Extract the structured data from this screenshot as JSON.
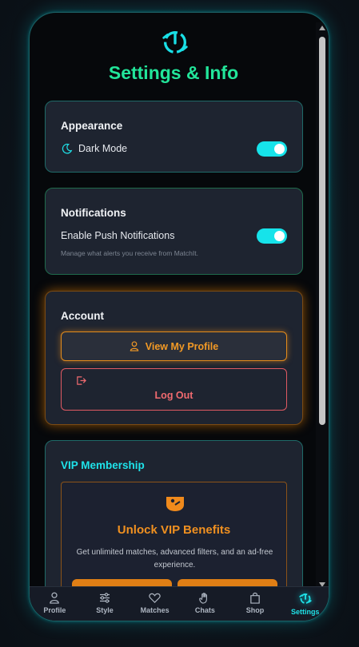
{
  "app": {
    "title": "Settings & Info"
  },
  "appearance": {
    "title": "Appearance",
    "dark_mode_label": "Dark Mode",
    "dark_mode_on": true
  },
  "notifications": {
    "title": "Notifications",
    "push_label": "Enable Push Notifications",
    "push_on": true,
    "help": "Manage what alerts you receive from MatchIt."
  },
  "account": {
    "title": "Account",
    "view_profile_label": "View My Profile",
    "logout_label": "Log Out"
  },
  "vip": {
    "title": "VIP Membership",
    "headline": "Unlock VIP Benefits",
    "description": "Get unlimited matches, advanced filters, and an ad-free experience."
  },
  "nav": {
    "items": [
      {
        "label": "Profile",
        "icon": "user-icon"
      },
      {
        "label": "Style",
        "icon": "sliders-icon"
      },
      {
        "label": "Matches",
        "icon": "heart-icon"
      },
      {
        "label": "Chats",
        "icon": "hand-icon"
      },
      {
        "label": "Shop",
        "icon": "shopping-bag-icon"
      },
      {
        "label": "Settings",
        "icon": "settings-power-icon",
        "active": true
      }
    ]
  },
  "colors": {
    "accent_cyan": "#16e3ea",
    "accent_green": "#22e59a",
    "accent_orange": "#f39a25",
    "danger": "#f06a6f",
    "card_bg": "#1e2430"
  }
}
